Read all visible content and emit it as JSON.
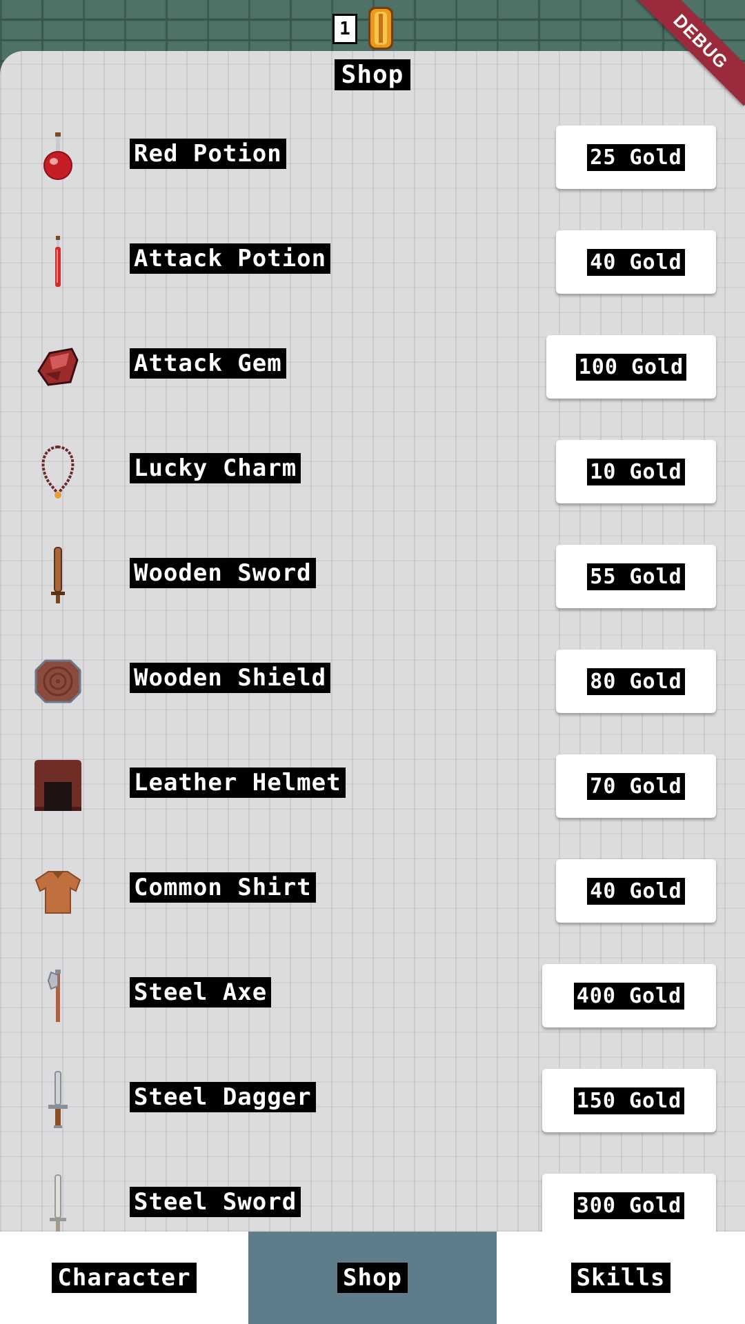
{
  "hud": {
    "gold_count": "1",
    "debug_label": "DEBUG"
  },
  "shop": {
    "title": "Shop",
    "items": [
      {
        "name": "Red Potion",
        "price": "25 Gold",
        "icon": "red-potion-icon"
      },
      {
        "name": "Attack Potion",
        "price": "40 Gold",
        "icon": "attack-potion-icon"
      },
      {
        "name": "Attack Gem",
        "price": "100 Gold",
        "icon": "attack-gem-icon"
      },
      {
        "name": "Lucky Charm",
        "price": "10 Gold",
        "icon": "lucky-charm-icon"
      },
      {
        "name": "Wooden Sword",
        "price": "55 Gold",
        "icon": "wooden-sword-icon"
      },
      {
        "name": "Wooden Shield",
        "price": "80 Gold",
        "icon": "wooden-shield-icon"
      },
      {
        "name": "Leather Helmet",
        "price": "70 Gold",
        "icon": "leather-helmet-icon"
      },
      {
        "name": "Common Shirt",
        "price": "40 Gold",
        "icon": "common-shirt-icon"
      },
      {
        "name": "Steel Axe",
        "price": "400 Gold",
        "icon": "steel-axe-icon"
      },
      {
        "name": "Steel Dagger",
        "price": "150 Gold",
        "icon": "steel-dagger-icon"
      },
      {
        "name": "Steel Sword",
        "price": "300 Gold",
        "icon": "steel-sword-icon"
      }
    ]
  },
  "nav": {
    "tabs": [
      {
        "label": "Character",
        "active": false
      },
      {
        "label": "Shop",
        "active": true
      },
      {
        "label": "Skills",
        "active": false
      }
    ]
  },
  "colors": {
    "nav_active": "#5f7c8a",
    "debug_ribbon": "#9b2a3a",
    "wall": "#4f7268"
  }
}
